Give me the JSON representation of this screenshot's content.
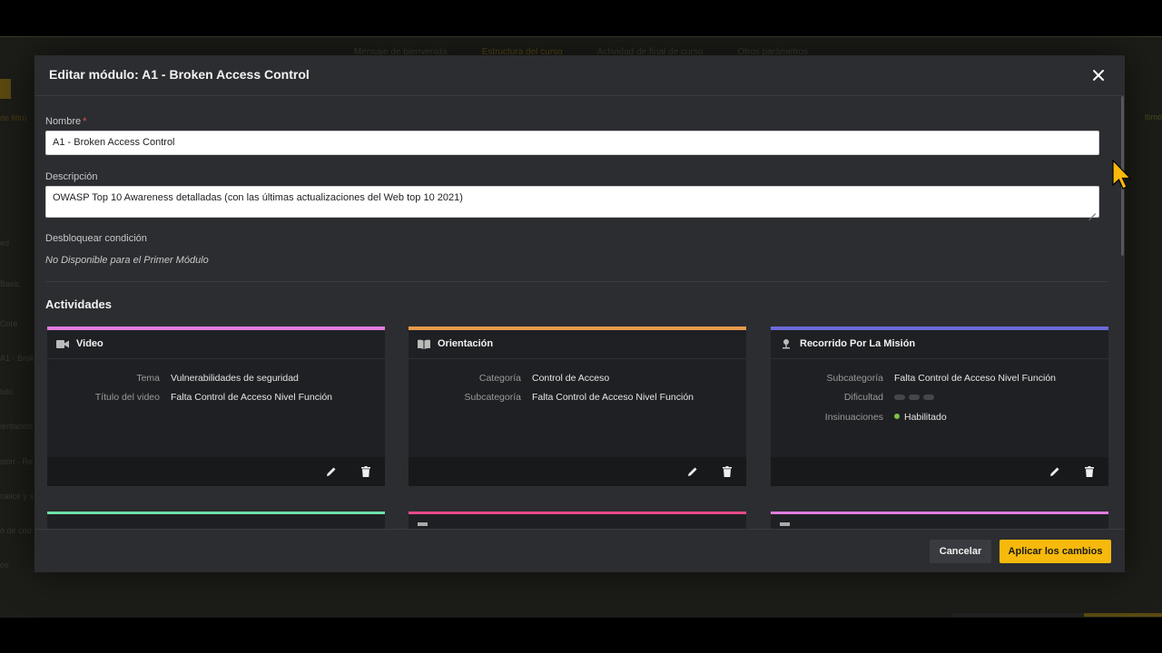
{
  "background": {
    "tabs": [
      "Mensaje de bienvenida",
      "Estructura del curso",
      "Actividad de final de curso",
      "Otros parámetros"
    ],
    "active_tab_index": 1,
    "side_items": [
      "ed",
      "Basic",
      "Core",
      "A1 - Broken",
      "lido",
      "ientación",
      "sión - Re",
      "calice y s",
      "o de cod",
      "os"
    ],
    "left_text": "de filtro",
    "right_text": "ltimo"
  },
  "modal": {
    "title": "Editar módulo: A1 - Broken Access Control",
    "close_icon": "close-icon",
    "fields": {
      "name_label": "Nombre",
      "required_mark": "*",
      "name_value": "A1 - Broken Access Control",
      "description_label": "Descripción",
      "description_value": "OWASP Top 10 Awareness detalladas (con las últimas actualizaciones del Web top 10 2021)",
      "unlock_label": "Desbloquear condición",
      "unlock_value": "No Disponible para el Primer Módulo"
    },
    "activities_title": "Actividades",
    "cards": [
      {
        "title": "Video",
        "icon": "video-icon",
        "color": "#e07be0",
        "rows": [
          {
            "key": "Tema",
            "value": "Vulnerabilidades de seguridad"
          },
          {
            "key": "Título del video",
            "value": "Falta Control de Acceso Nivel Función"
          }
        ]
      },
      {
        "title": "Orientación",
        "icon": "book-icon",
        "color": "#e89a4a",
        "rows": [
          {
            "key": "Categoría",
            "value": "Control de Acceso"
          },
          {
            "key": "Subcategoría",
            "value": "Falta Control de Acceso Nivel Función"
          }
        ]
      },
      {
        "title": "Recorrido Por La Misión",
        "icon": "mission-pin-icon",
        "color": "#6b6bd8",
        "rows": [
          {
            "key": "Subcategoría",
            "value": "Falta Control de Acceso Nivel Función"
          },
          {
            "key": "Dificultad",
            "value": ""
          },
          {
            "key": "Insinuaciones",
            "value": "Habilitado"
          }
        ]
      }
    ],
    "partial_cards": [
      {
        "color": "#6ee0a8"
      },
      {
        "color": "#e84a8a"
      },
      {
        "color": "#e07be0"
      }
    ],
    "edit_icon": "pencil-icon",
    "delete_icon": "trash-icon",
    "footer": {
      "cancel_label": "Cancelar",
      "apply_label": "Aplicar los cambios"
    }
  }
}
